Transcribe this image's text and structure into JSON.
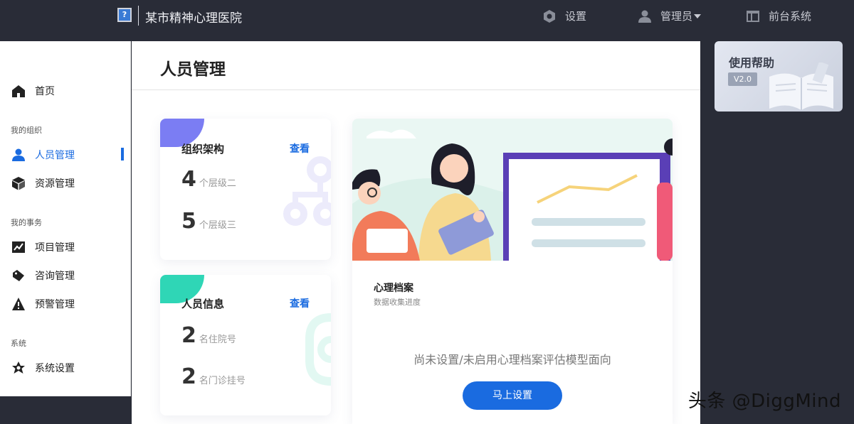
{
  "header": {
    "logo_glyph": "?",
    "app_title": "某市精神心理医院",
    "settings_label": "设置",
    "admin_label": "管理员",
    "frontend_label": "前台系统"
  },
  "sidebar": {
    "home": "首页",
    "group_org": "我的组织",
    "personnel": "人员管理",
    "resources": "资源管理",
    "group_affairs": "我的事务",
    "projects": "项目管理",
    "consult": "咨询管理",
    "warning": "预警管理",
    "group_system": "系统",
    "system_settings": "系统设置"
  },
  "page": {
    "title": "人员管理"
  },
  "org_card": {
    "title": "组织架构",
    "view_label": "查看",
    "stats": [
      {
        "num": "4",
        "unit": "个层级二"
      },
      {
        "num": "5",
        "unit": "个层级三"
      }
    ],
    "tab_color": "#7b7df3"
  },
  "staff_card": {
    "title": "人员信息",
    "view_label": "查看",
    "stats": [
      {
        "num": "2",
        "unit": "名住院号"
      },
      {
        "num": "2",
        "unit": "名门诊挂号"
      }
    ],
    "tab_color": "#2fd6b6"
  },
  "archive_card": {
    "title": "心理档案",
    "desc": "数据收集进度",
    "empty_message": "尚未设置/未启用心理档案评估模型面向",
    "button_label": "马上设置"
  },
  "help": {
    "title": "使用帮助",
    "version": "V2.0"
  },
  "watermark": "头条 @DiggMind",
  "colors": {
    "accent": "#1a6be0",
    "topbar": "#292c37"
  }
}
